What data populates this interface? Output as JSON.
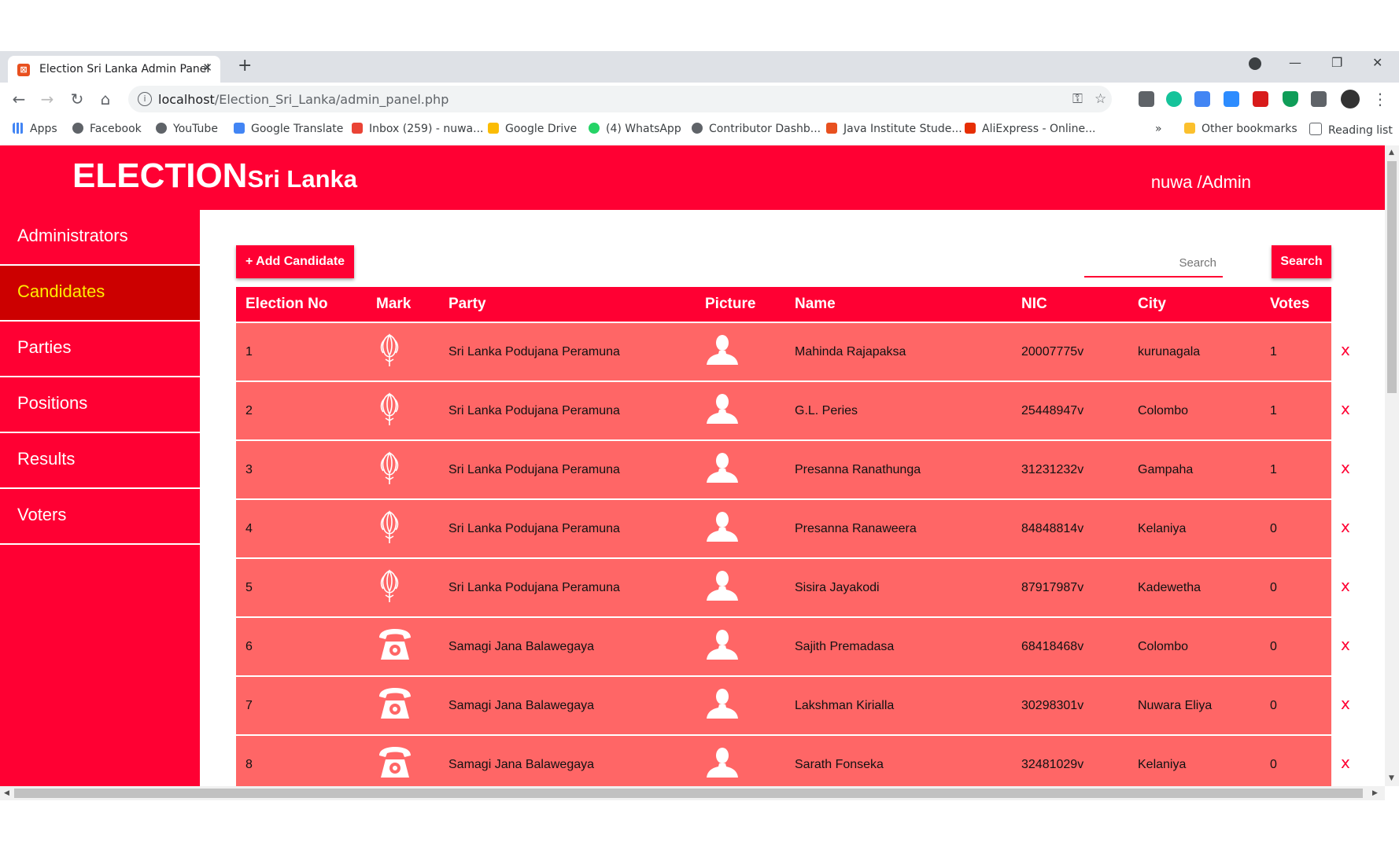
{
  "browser": {
    "tab_title": "Election Sri Lanka Admin Panel",
    "new_tab": "+",
    "url_host": "localhost",
    "url_path": "/Election_Sri_Lanka/admin_panel.php",
    "bookmarks": [
      "Apps",
      "Facebook",
      "YouTube",
      "Google Translate",
      "Inbox (259) - nuwa...",
      "Google Drive",
      "(4) WhatsApp",
      "Contributor Dashb...",
      "Java Institute Stude...",
      "AliExpress - Online..."
    ],
    "bookmarks_more": "»",
    "other_bookmarks": "Other bookmarks",
    "reading_list": "Reading list"
  },
  "header": {
    "brand_main": "ELECTION",
    "brand_sub": "Sri Lanka",
    "user": "nuwa /Admin"
  },
  "sidebar": {
    "items": [
      "Administrators",
      "Candidates",
      "Parties",
      "Positions",
      "Results",
      "Voters"
    ],
    "active": "Candidates"
  },
  "toolbar": {
    "add_label": "+ Add Candidate",
    "search_placeholder": "Search",
    "search_label": "Search"
  },
  "table": {
    "columns": [
      "Election No",
      "Mark",
      "Party",
      "Picture",
      "Name",
      "NIC",
      "City",
      "Votes"
    ],
    "rows": [
      {
        "no": "1",
        "mark": "flower-icon",
        "party": "Sri Lanka Podujana Peramuna",
        "name": "Mahinda Rajapaksa",
        "nic": "20007775v",
        "city": "kurunagala",
        "votes": "1"
      },
      {
        "no": "2",
        "mark": "flower-icon",
        "party": "Sri Lanka Podujana Peramuna",
        "name": "G.L. Peries",
        "nic": "25448947v",
        "city": "Colombo",
        "votes": "1"
      },
      {
        "no": "3",
        "mark": "flower-icon",
        "party": "Sri Lanka Podujana Peramuna",
        "name": "Presanna Ranathunga",
        "nic": "31231232v",
        "city": "Gampaha",
        "votes": "1"
      },
      {
        "no": "4",
        "mark": "flower-icon",
        "party": "Sri Lanka Podujana Peramuna",
        "name": "Presanna Ranaweera",
        "nic": "84848814v",
        "city": "Kelaniya",
        "votes": "0"
      },
      {
        "no": "5",
        "mark": "flower-icon",
        "party": "Sri Lanka Podujana Peramuna",
        "name": "Sisira Jayakodi",
        "nic": "87917987v",
        "city": "Kadewetha",
        "votes": "0"
      },
      {
        "no": "6",
        "mark": "telephone-icon",
        "party": "Samagi Jana Balawegaya",
        "name": "Sajith Premadasa",
        "nic": "68418468v",
        "city": "Colombo",
        "votes": "0"
      },
      {
        "no": "7",
        "mark": "telephone-icon",
        "party": "Samagi Jana Balawegaya",
        "name": "Lakshman Kirialla",
        "nic": "30298301v",
        "city": "Nuwara Eliya",
        "votes": "0"
      },
      {
        "no": "8",
        "mark": "telephone-icon",
        "party": "Samagi Jana Balawegaya",
        "name": "Sarath Fonseka",
        "nic": "32481029v",
        "city": "Kelaniya",
        "votes": "0"
      }
    ],
    "delete_glyph": "x"
  },
  "colors": {
    "primary": "#ff0033",
    "row": "#ff6666",
    "active_nav": "#cc0000",
    "active_text": "#ffee00"
  }
}
